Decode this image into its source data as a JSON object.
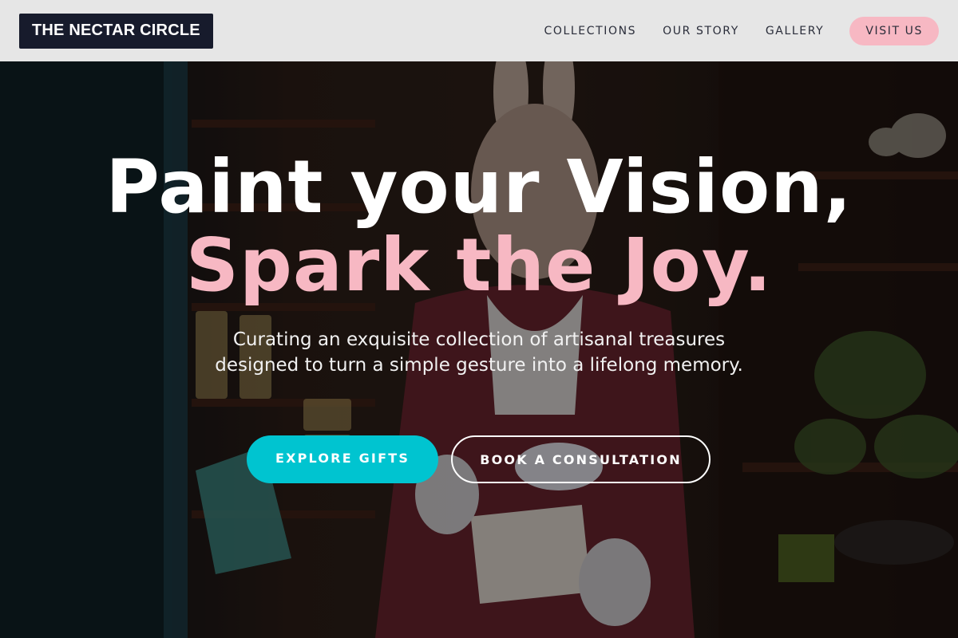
{
  "brand": {
    "name": "THE NECTAR CIRCLE"
  },
  "nav": {
    "items": [
      {
        "label": "COLLECTIONS"
      },
      {
        "label": "OUR STORY"
      },
      {
        "label": "GALLERY"
      }
    ],
    "cta_label": "VISIT US"
  },
  "hero": {
    "headline_line1": "Paint your Vision,",
    "headline_line2": "Spark the Joy.",
    "subtitle": "Curating an exquisite collection of artisanal treasures designed to turn a simple gesture into a lifelong memory.",
    "primary_button": "EXPLORE GIFTS",
    "secondary_button": "BOOK A CONSULTATION"
  },
  "colors": {
    "header_bg": "#e6e6e6",
    "logo_bg": "#171b2c",
    "accent_pink": "#f7b8c3",
    "accent_cyan": "#00c4d0"
  }
}
